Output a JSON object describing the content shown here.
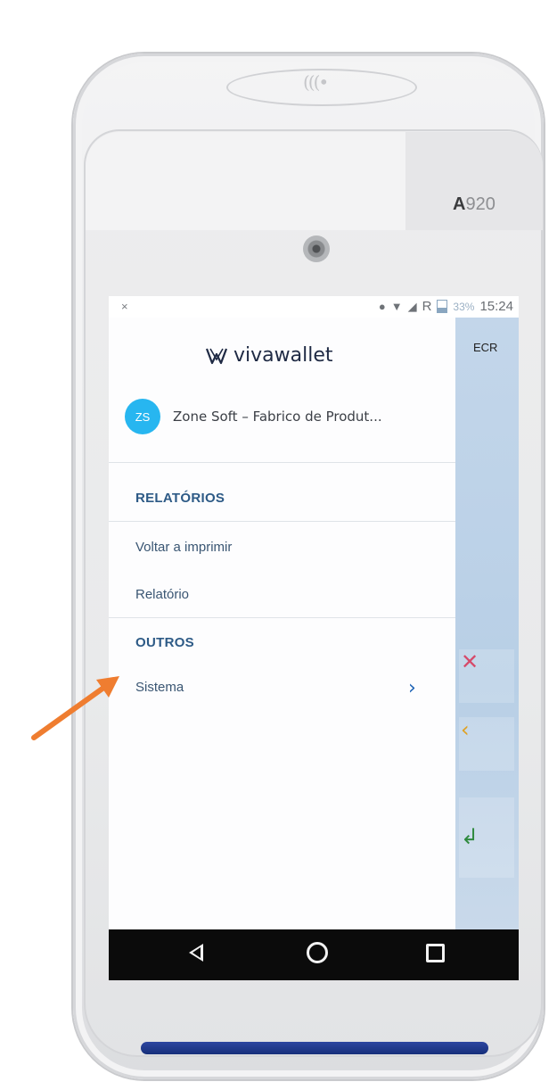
{
  "device": {
    "model_bold": "A",
    "model_rest": "920",
    "nfc_symbol": "(((•"
  },
  "status_bar": {
    "left_icon": "×",
    "signal_text": "R",
    "battery": "33%",
    "time": "15:24"
  },
  "background_app": {
    "title": "ECR",
    "keys": [
      {
        "icon": "close-icon",
        "glyph": "✕",
        "color": "#d64a6a"
      },
      {
        "icon": "backspace-icon",
        "glyph": "‹",
        "color": "#e0a020"
      },
      {
        "icon": "enter-icon",
        "glyph": "↲",
        "color": "#2f8a3e"
      }
    ]
  },
  "drawer": {
    "logo_text": "vivawallet",
    "account": {
      "initials": "ZS",
      "name": "Zone Soft – Fabrico de Produt..."
    },
    "sections": [
      {
        "title": "RELATÓRIOS",
        "items": [
          "Voltar a imprimir",
          "Relatório"
        ]
      },
      {
        "title": "OUTROS",
        "items": [
          "Sistema"
        ]
      }
    ]
  },
  "nav_bar": {
    "back": "back-icon",
    "home": "home-icon",
    "recent": "recent-apps-icon"
  },
  "annotation": {
    "arrow_color": "#ef7d30"
  }
}
